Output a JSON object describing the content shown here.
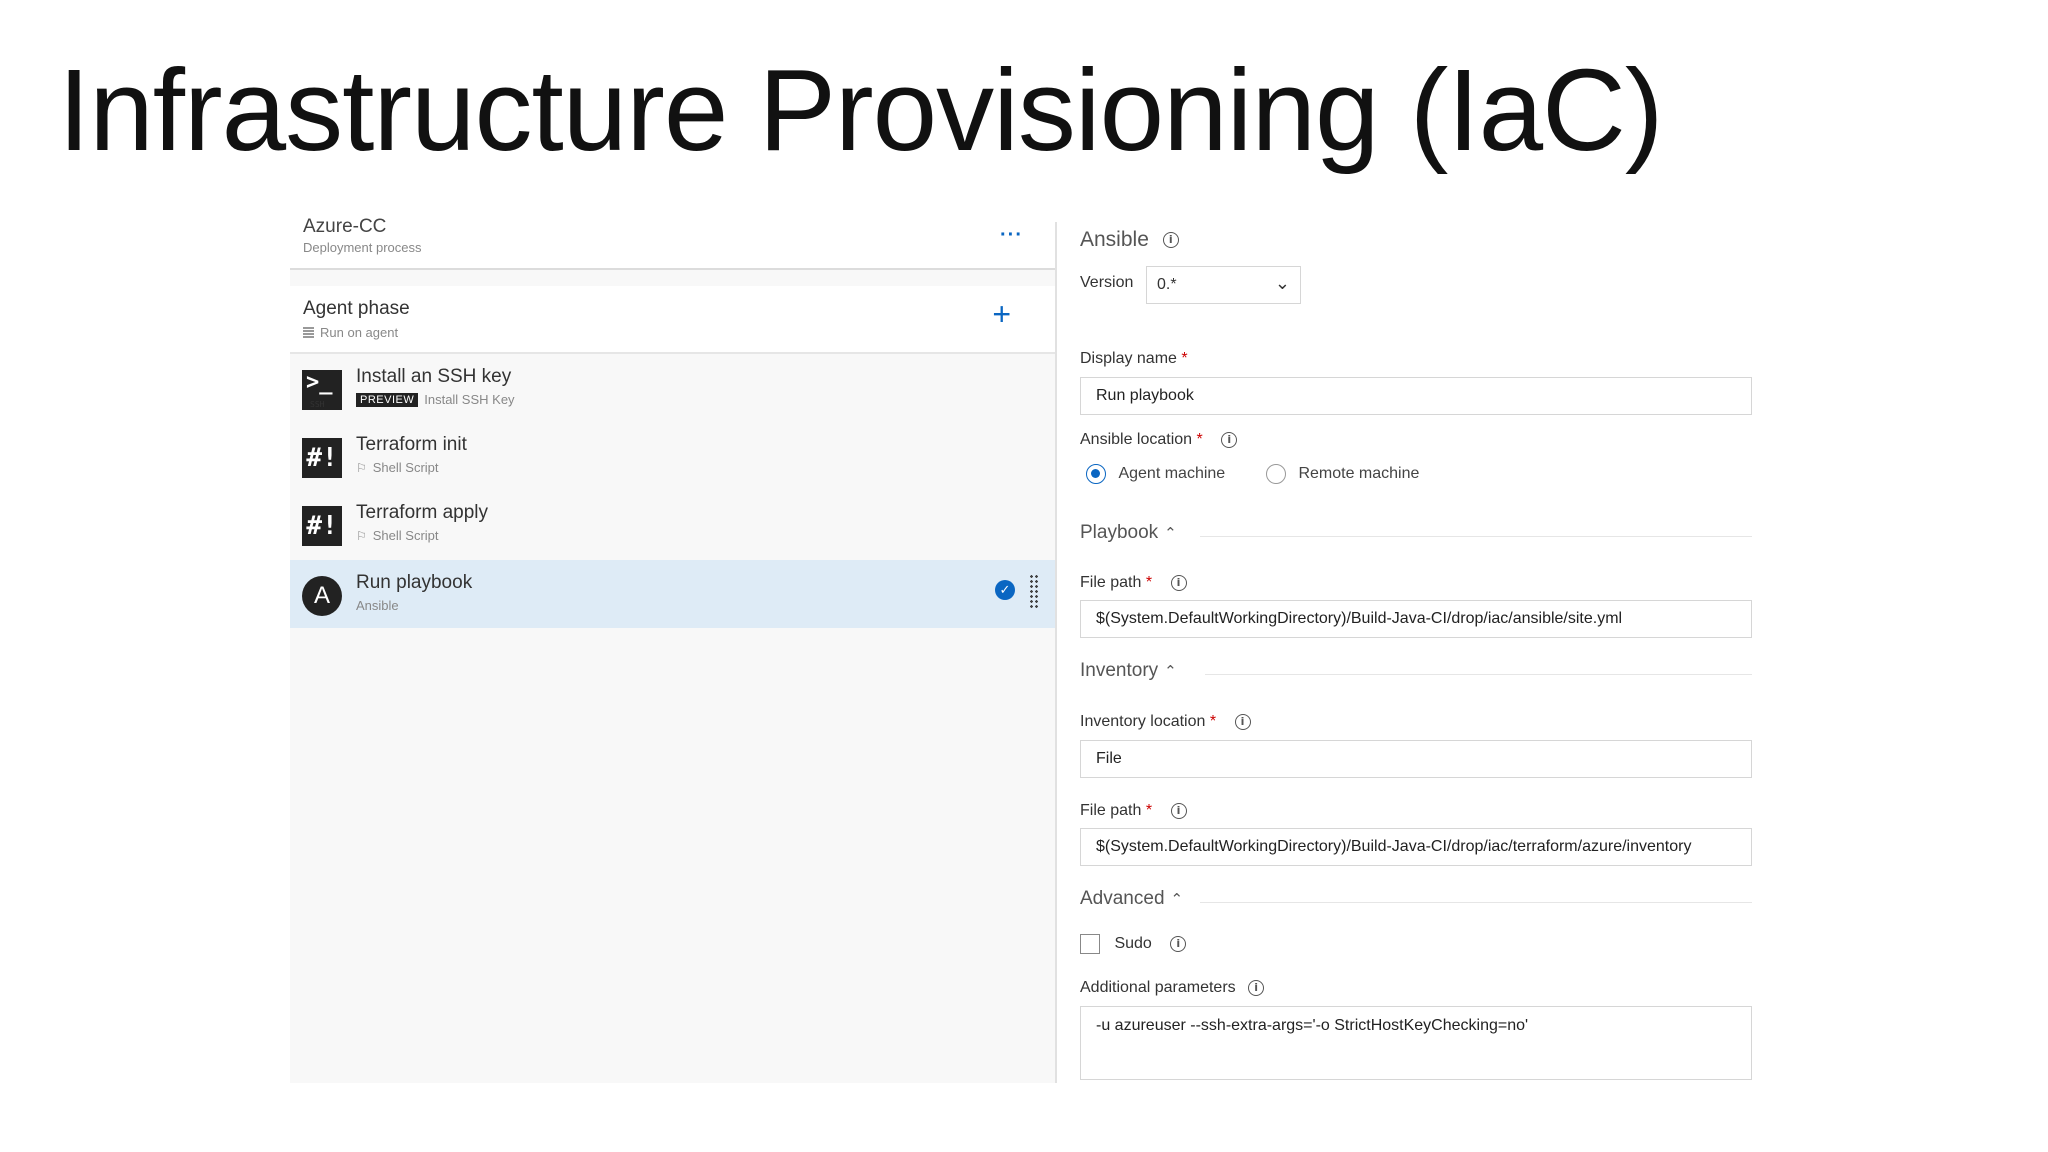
{
  "slide": {
    "title": "Infrastructure Provisioning (IaC)"
  },
  "left": {
    "process_title": "Azure-CC",
    "process_subtitle": "Deployment process",
    "more_label": "···",
    "phase": {
      "title": "Agent phase",
      "subtitle": "Run on agent",
      "add_label": "+"
    },
    "tasks": [
      {
        "title": "Install an SSH key",
        "badge": "PREVIEW",
        "subtitle": "Install SSH Key",
        "icon": "terminal-ssh-icon",
        "icon_text": "SSH"
      },
      {
        "title": "Terraform init",
        "subtitle": "Shell Script",
        "icon": "shell-script-icon",
        "icon_text": "#!"
      },
      {
        "title": "Terraform apply",
        "subtitle": "Shell Script",
        "icon": "shell-script-icon",
        "icon_text": "#!"
      },
      {
        "title": "Run playbook",
        "subtitle": "Ansible",
        "icon": "ansible-icon",
        "icon_text": "A"
      }
    ]
  },
  "right": {
    "task_name": "Ansible",
    "version_label": "Version",
    "version_value": "0.*",
    "display_name_label": "Display name",
    "display_name_value": "Run playbook",
    "ansible_location_label": "Ansible location",
    "location_options": [
      "Agent machine",
      "Remote machine"
    ],
    "location_selected": "Agent machine",
    "playbook_section": "Playbook",
    "playbook_file_path_label": "File path",
    "playbook_file_path_value": "$(System.DefaultWorkingDirectory)/Build-Java-CI/drop/iac/ansible/site.yml",
    "inventory_section": "Inventory",
    "inventory_location_label": "Inventory location",
    "inventory_location_value": "File",
    "inventory_file_path_label": "File path",
    "inventory_file_path_value": "$(System.DefaultWorkingDirectory)/Build-Java-CI/drop/iac/terraform/azure/inventory",
    "advanced_section": "Advanced",
    "sudo_label": "Sudo",
    "sudo_checked": false,
    "additional_params_label": "Additional parameters",
    "additional_params_value": "-u azureuser --ssh-extra-args='-o StrictHostKeyChecking=no'",
    "required_mark": "*",
    "info_glyph": "i"
  },
  "colors": {
    "accent": "#0a66c2",
    "selected_row": "#deebf6",
    "required": "#cc0000"
  }
}
